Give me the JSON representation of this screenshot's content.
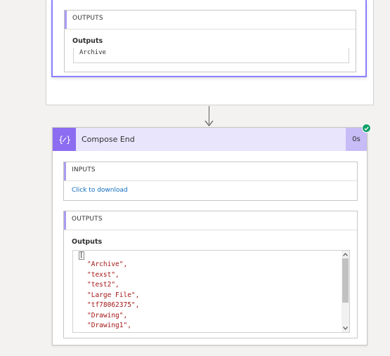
{
  "previous_action": {
    "outputs_section_title": "OUTPUTS",
    "outputs_label": "Outputs",
    "outputs_value": "Archive"
  },
  "compose_end": {
    "title": "Compose End",
    "duration": "0s",
    "status": "succeeded",
    "icon": "compose-braces-icon",
    "inputs_section_title": "INPUTS",
    "download_link": "Click to download",
    "outputs_section_title": "OUTPUTS",
    "outputs_label": "Outputs",
    "outputs_open_bracket": "[",
    "outputs_lines": [
      "\"Archive\",",
      "\"texst\",",
      "\"test2\",",
      "\"Large File\",",
      "\"tf78062375\",",
      "\"Drawing\",",
      "\"Drawing1\","
    ]
  },
  "colors": {
    "accent_purple": "#8b80ff",
    "header_bg": "#e9e5fd",
    "icon_bg": "#8c6cf0",
    "success_green": "#11a069",
    "link_blue": "#0f6cbd",
    "json_string_red": "#a31515"
  }
}
